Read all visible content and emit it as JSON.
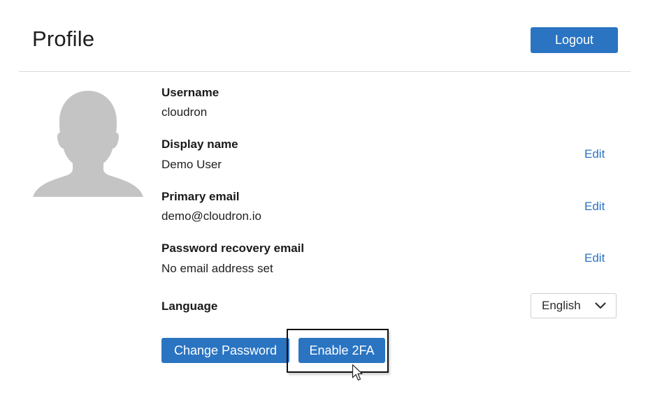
{
  "header": {
    "title": "Profile",
    "logout_label": "Logout"
  },
  "avatar": {
    "icon": "user-silhouette-icon"
  },
  "fields": {
    "username": {
      "label": "Username",
      "value": "cloudron"
    },
    "display_name": {
      "label": "Display name",
      "value": "Demo User",
      "edit_label": "Edit"
    },
    "primary_email": {
      "label": "Primary email",
      "value": "demo@cloudron.io",
      "edit_label": "Edit"
    },
    "recovery_email": {
      "label": "Password recovery email",
      "value": "No email address set",
      "edit_label": "Edit"
    },
    "language": {
      "label": "Language",
      "selected": "English"
    }
  },
  "actions": {
    "change_password_label": "Change Password",
    "enable_2fa_label": "Enable 2FA"
  },
  "colors": {
    "accent": "#2a74c2",
    "avatar_gray": "#c4c4c4",
    "divider": "#d9d9d9"
  }
}
